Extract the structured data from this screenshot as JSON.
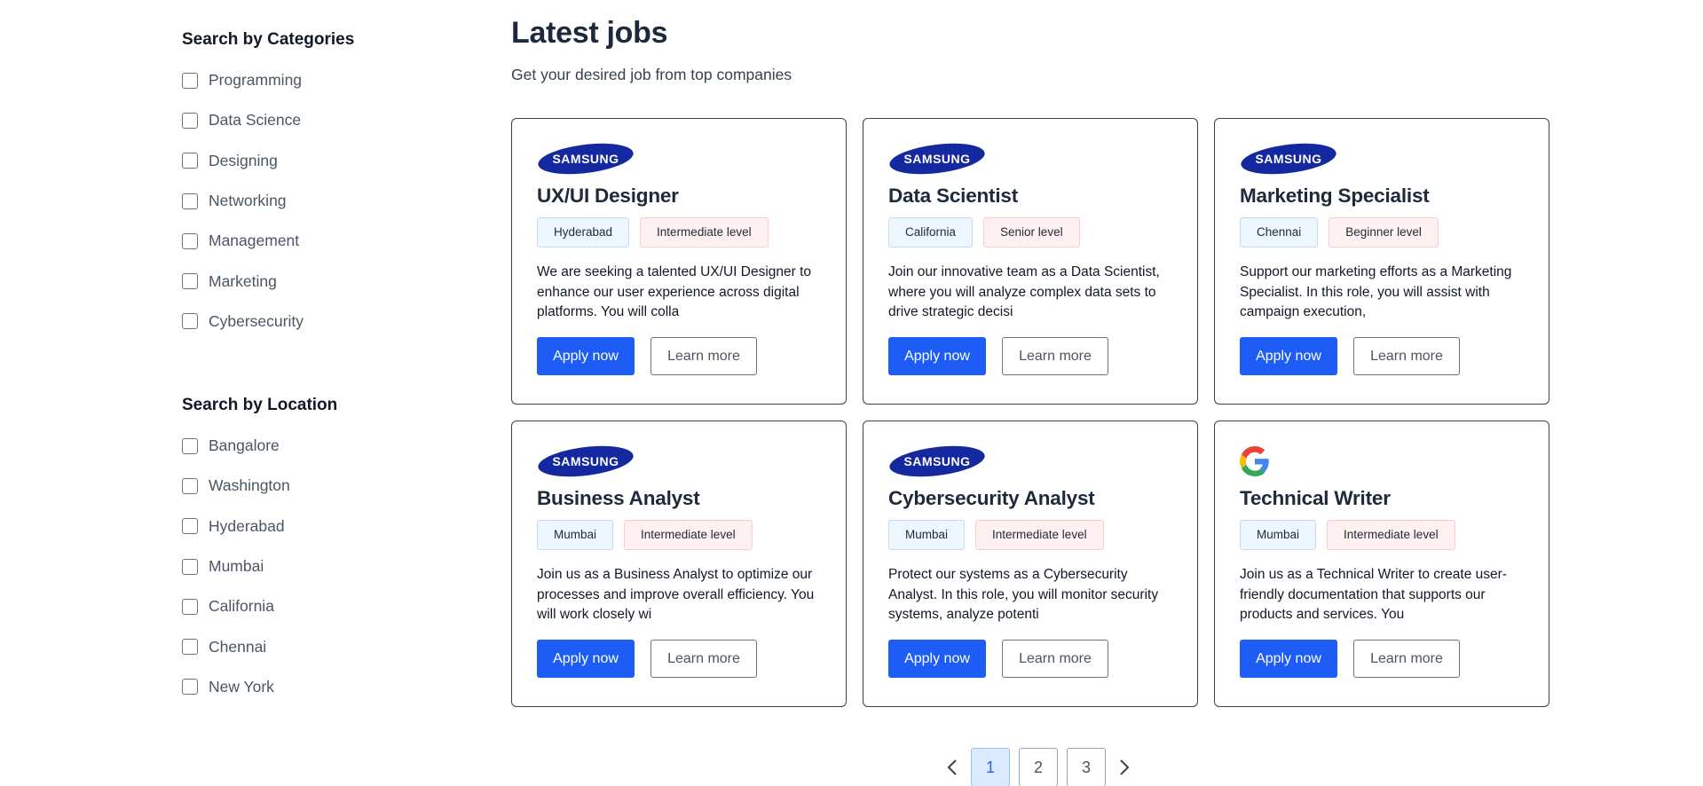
{
  "filters": {
    "categories": {
      "title": "Search by Categories",
      "items": [
        "Programming",
        "Data Science",
        "Designing",
        "Networking",
        "Management",
        "Marketing",
        "Cybersecurity"
      ]
    },
    "location": {
      "title": "Search by Location",
      "items": [
        "Bangalore",
        "Washington",
        "Hyderabad",
        "Mumbai",
        "California",
        "Chennai",
        "New York"
      ]
    }
  },
  "main": {
    "title": "Latest jobs",
    "subtitle": "Get your desired job from top companies"
  },
  "jobs": [
    {
      "company_logo": "samsung-logo",
      "logo_text": "SAMSUNG",
      "title": "UX/UI Designer",
      "location": "Hyderabad",
      "level": "Intermediate level",
      "description": "We are seeking a talented UX/UI Designer to enhance our user experience across digital platforms. You will colla",
      "apply_label": "Apply now",
      "learn_label": "Learn more"
    },
    {
      "company_logo": "samsung-logo",
      "logo_text": "SAMSUNG",
      "title": "Data Scientist",
      "location": "California",
      "level": "Senior level",
      "description": "Join our innovative team as a Data Scientist, where you will analyze complex data sets to drive strategic decisi",
      "apply_label": "Apply now",
      "learn_label": "Learn more"
    },
    {
      "company_logo": "samsung-logo",
      "logo_text": "SAMSUNG",
      "title": "Marketing Specialist",
      "location": "Chennai",
      "level": "Beginner level",
      "description": "Support our marketing efforts as a Marketing Specialist. In this role, you will assist with campaign execution,",
      "apply_label": "Apply now",
      "learn_label": "Learn more"
    },
    {
      "company_logo": "samsung-logo",
      "logo_text": "SAMSUNG",
      "title": "Business Analyst",
      "location": "Mumbai",
      "level": "Intermediate level",
      "description": "Join us as a Business Analyst to optimize our processes and improve overall efficiency. You will work closely wi",
      "apply_label": "Apply now",
      "learn_label": "Learn more"
    },
    {
      "company_logo": "samsung-logo",
      "logo_text": "SAMSUNG",
      "title": "Cybersecurity Analyst",
      "location": "Mumbai",
      "level": "Intermediate level",
      "description": "Protect our systems as a Cybersecurity Analyst. In this role, you will monitor security systems, analyze potenti",
      "apply_label": "Apply now",
      "learn_label": "Learn more"
    },
    {
      "company_logo": "google-logo",
      "logo_text": "",
      "title": "Technical Writer",
      "location": "Mumbai",
      "level": "Intermediate level",
      "description": "Join us as a Technical Writer to create user-friendly documentation that supports our products and services. You",
      "apply_label": "Apply now",
      "learn_label": "Learn more"
    }
  ],
  "pagination": {
    "pages": [
      "1",
      "2",
      "3"
    ],
    "current": "1",
    "prev_icon": "chevron-left-icon",
    "next_icon": "chevron-right-icon"
  },
  "colors": {
    "primary": "#1d5cf5",
    "samsung_blue": "#1428a0",
    "active_page_bg": "#dbeafe"
  }
}
